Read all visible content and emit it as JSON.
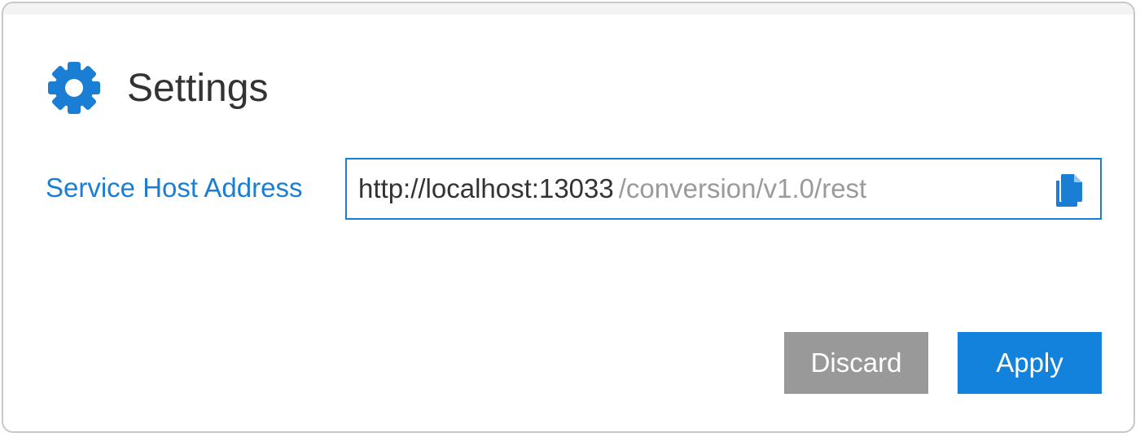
{
  "dialog": {
    "title": "Settings",
    "title_icon": "gear-icon",
    "accent_color": "#1a7fd4"
  },
  "service_host": {
    "label": "Service Host Address",
    "host": "http://localhost:13033",
    "path": "/conversion/v1.0/rest",
    "copy_icon": "copy-icon"
  },
  "actions": {
    "discard_label": "Discard",
    "apply_label": "Apply"
  }
}
